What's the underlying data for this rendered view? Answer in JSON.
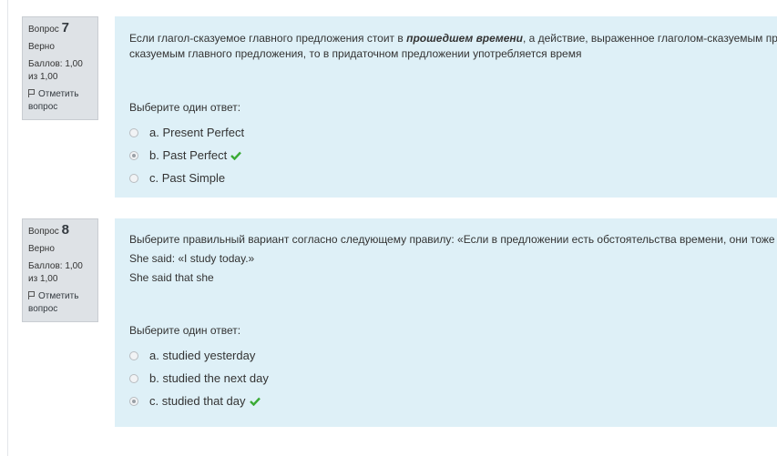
{
  "questions": [
    {
      "label": "Вопрос",
      "number": "7",
      "state": "Верно",
      "grade": "Баллов: 1,00 из 1,00",
      "flag_label": "Отметить вопрос",
      "text_before": "Если глагол-сказуемое главного предложения стоит в ",
      "text_bold": "прошедшем времени",
      "text_after": ", а действие, выраженное глаголом-сказуемым придаточного предложения, предшествует действию, выраженному глаголом-",
      "text_line2": "сказуемым главного предложения, то в придаточном предложении употребляется время",
      "prompt": "Выберите один ответ:",
      "answers": [
        {
          "text": "a. Present Perfect",
          "checked": false,
          "correct": false
        },
        {
          "text": "b. Past Perfect",
          "checked": true,
          "correct": true
        },
        {
          "text": "c. Past Simple",
          "checked": false,
          "correct": false
        }
      ]
    },
    {
      "label": "Вопрос",
      "number": "8",
      "state": "Верно",
      "grade": "Баллов: 1,00 из 1,00",
      "flag_label": "Отметить вопрос",
      "para1": "Выберите правильный вариант согласно следующему правилу: «Если в предложении есть обстоятельства времени, они тоже меняются»",
      "para2": "She said: «I study today.»",
      "para3": "She said that she",
      "prompt": "Выберите один ответ:",
      "answers": [
        {
          "text": "a. studied yesterday",
          "checked": false,
          "correct": false
        },
        {
          "text": "b. studied the next day",
          "checked": false,
          "correct": false
        },
        {
          "text": "c. studied that day",
          "checked": true,
          "correct": true
        }
      ]
    }
  ],
  "colors": {
    "info_bg": "#dee2e6",
    "content_bg": "#def0f7",
    "correct_check": "#3aaa35"
  }
}
